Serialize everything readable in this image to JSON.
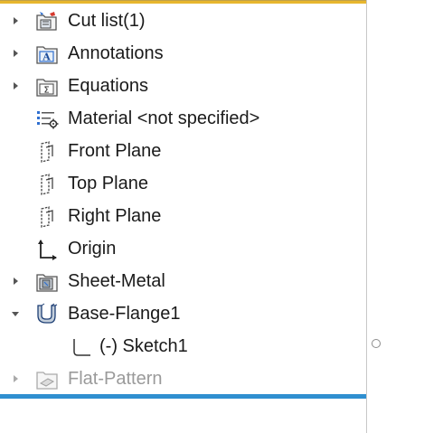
{
  "tree": {
    "items": [
      {
        "label": "Cut list(1)",
        "icon": "cut-list-icon",
        "expandable": true,
        "level": 1
      },
      {
        "label": "Annotations",
        "icon": "annotations-icon",
        "expandable": true,
        "level": 1
      },
      {
        "label": "Equations",
        "icon": "equations-icon",
        "expandable": true,
        "level": 1
      },
      {
        "label": "Material <not specified>",
        "icon": "material-icon",
        "expandable": false,
        "level": 1
      },
      {
        "label": "Front Plane",
        "icon": "plane-icon",
        "expandable": false,
        "level": 1
      },
      {
        "label": "Top Plane",
        "icon": "plane-icon",
        "expandable": false,
        "level": 1
      },
      {
        "label": "Right Plane",
        "icon": "plane-icon",
        "expandable": false,
        "level": 1
      },
      {
        "label": "Origin",
        "icon": "origin-icon",
        "expandable": false,
        "level": 1
      },
      {
        "label": "Sheet-Metal",
        "icon": "sheet-metal-icon",
        "expandable": true,
        "level": 1
      },
      {
        "label": "Base-Flange1",
        "icon": "base-flange-icon",
        "expandable": true,
        "expanded": true,
        "level": 1
      },
      {
        "label": "(-) Sketch1",
        "icon": "sketch-icon",
        "expandable": false,
        "level": 2
      },
      {
        "label": "Flat-Pattern",
        "icon": "flat-pattern-icon",
        "expandable": true,
        "disabled": true,
        "level": 1
      }
    ]
  },
  "colors": {
    "top_accent": "#e7b62e",
    "bottom_accent": "#2f8fd0",
    "text": "#1a1a1a",
    "disabled_text": "#9a9a9a"
  }
}
